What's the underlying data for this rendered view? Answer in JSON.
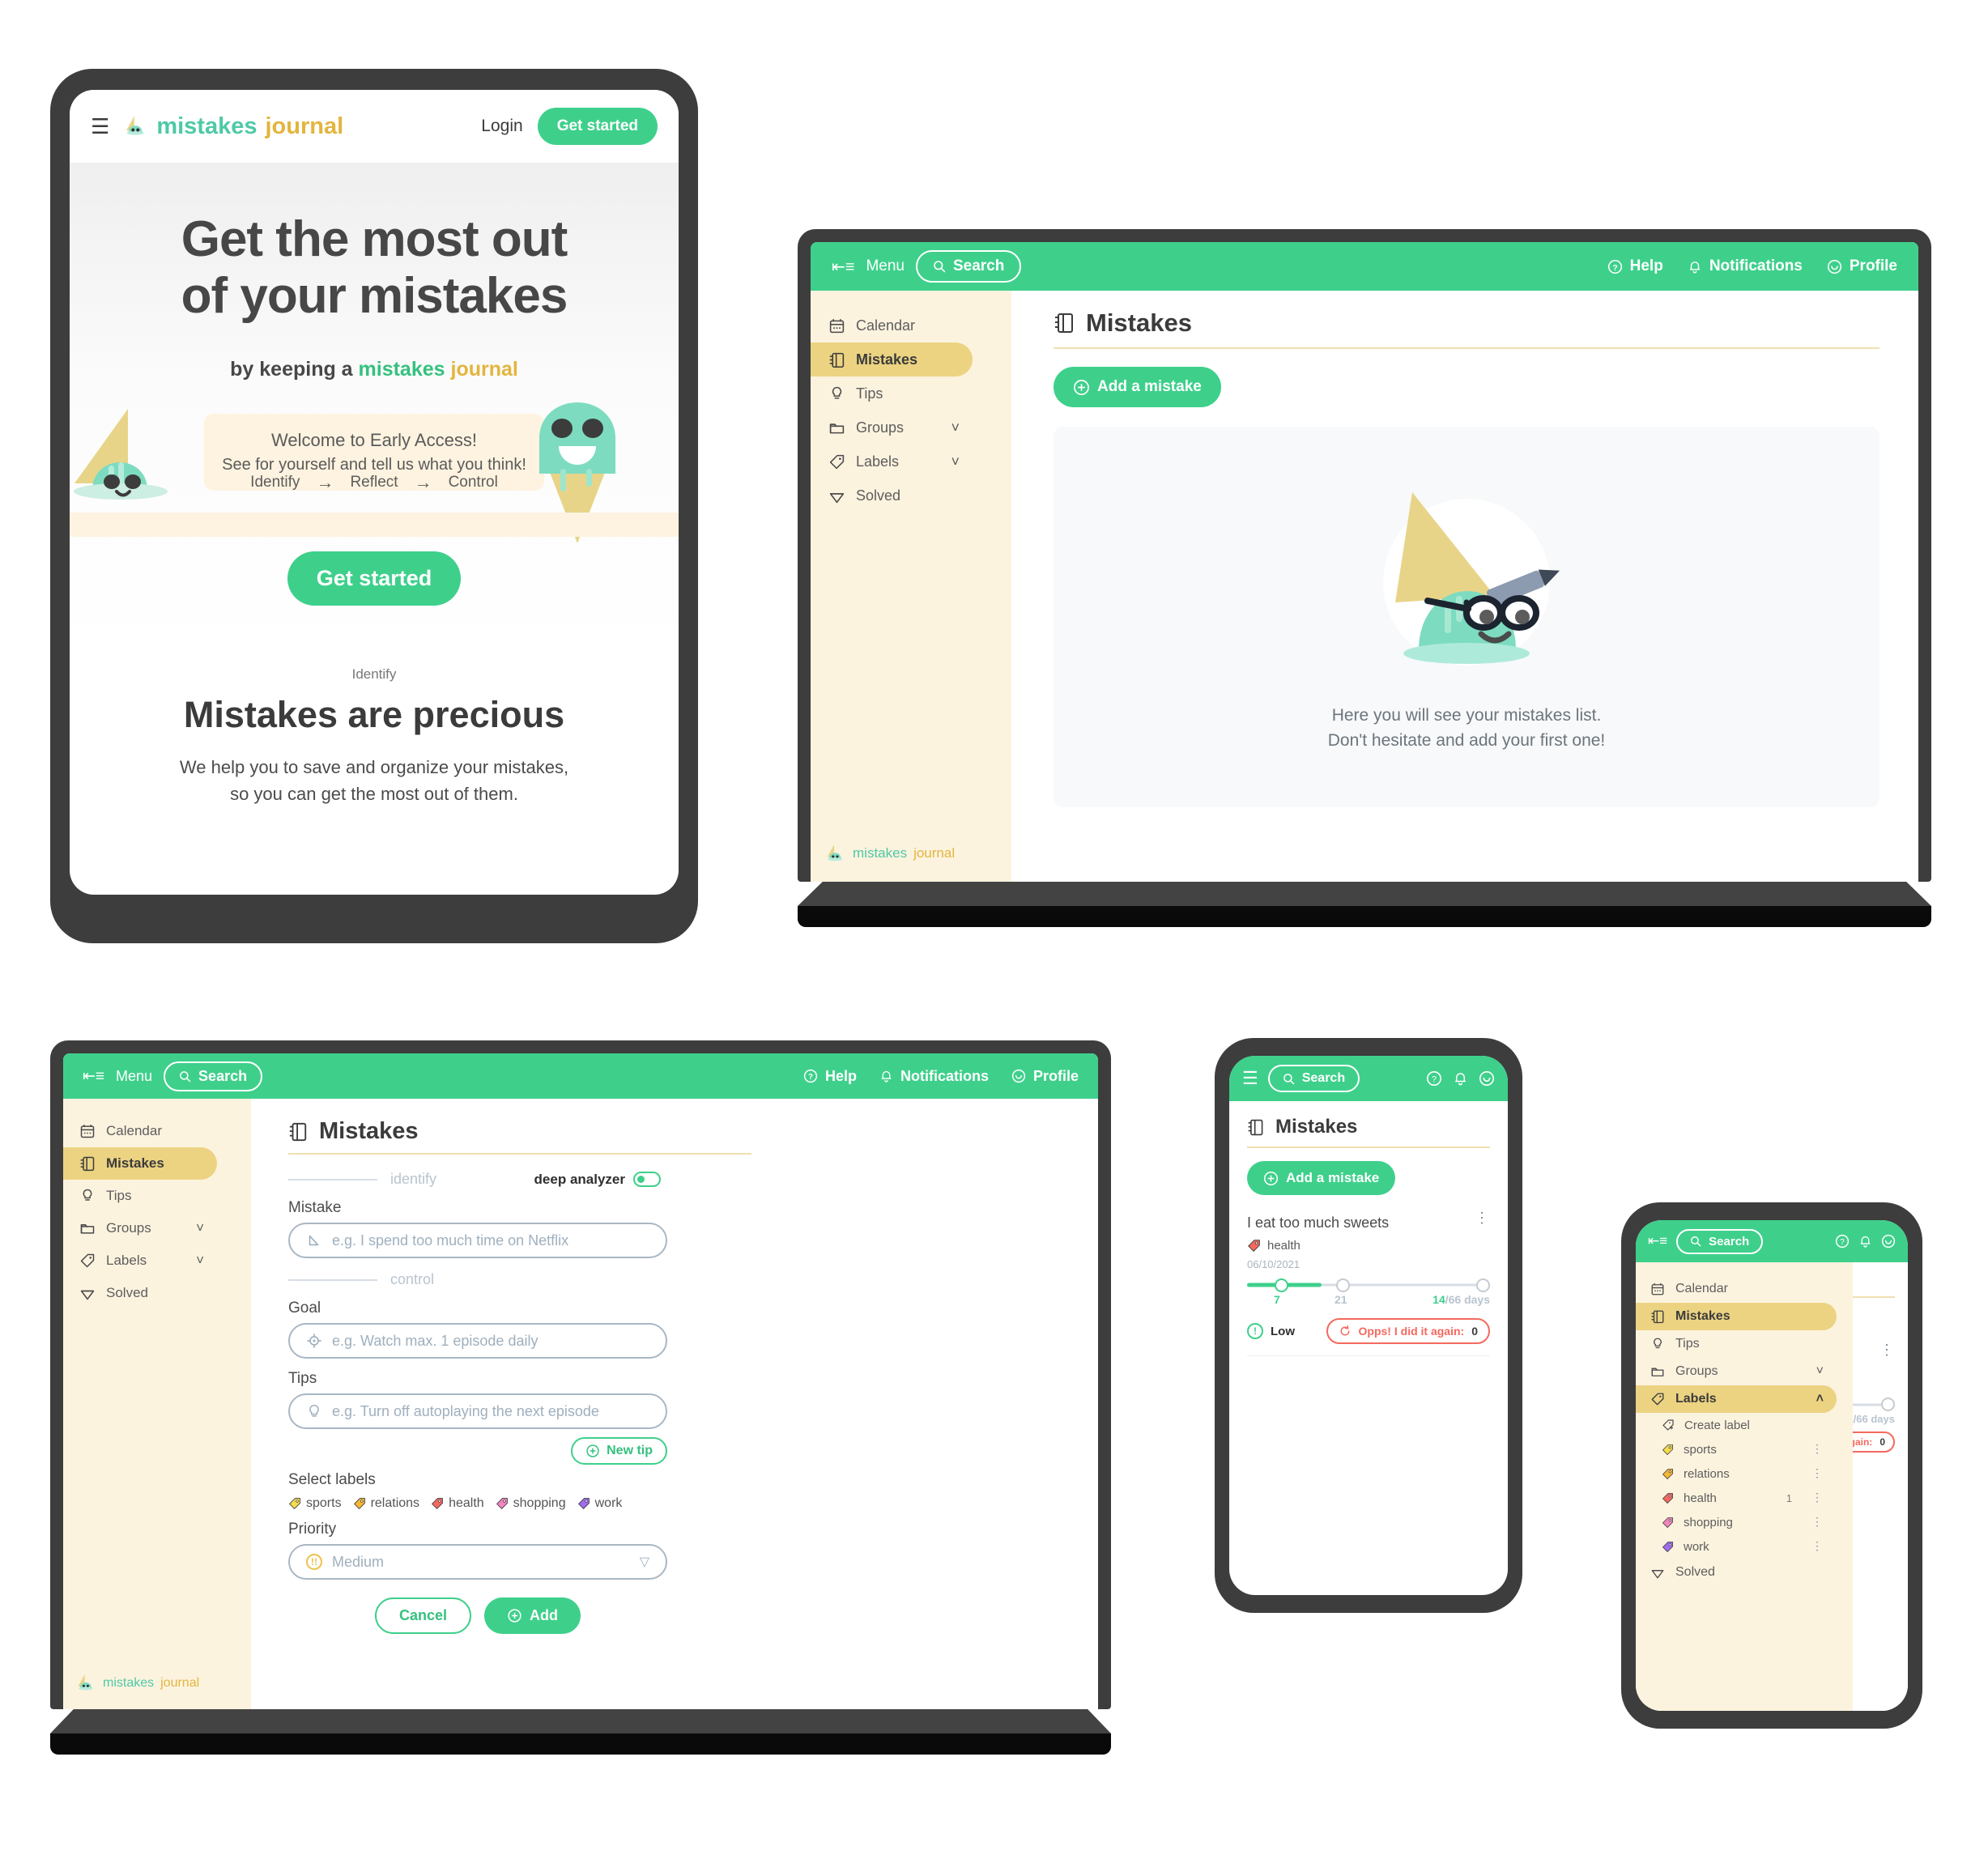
{
  "brand": {
    "name_first": "mistakes",
    "name_second": "journal"
  },
  "landing": {
    "nav": {
      "menu_icon": "hamburger-icon",
      "login": "Login",
      "cta": "Get started"
    },
    "hero": {
      "title_line1": "Get the most out",
      "title_line2": "of your mistakes",
      "subtitle_prefix": "by keeping a ",
      "subtitle_first": "mistakes",
      "subtitle_second": "journal",
      "notice_title": "Welcome to Early Access!",
      "notice_body": "See for yourself and tell us what you think!",
      "steps": [
        "Identify",
        "Reflect",
        "Control"
      ],
      "arrow": "→",
      "cta": "Get started"
    },
    "section": {
      "kicker": "Identify",
      "heading": "Mistakes are precious",
      "body_line1": "We help you to save and organize your mistakes,",
      "body_line2": "so you can get the most out of them."
    }
  },
  "appbar": {
    "menu_label": "Menu",
    "search_label": "Search",
    "help_label": "Help",
    "notifications_label": "Notifications",
    "profile_label": "Profile"
  },
  "sidebar": {
    "items": [
      {
        "label": "Calendar",
        "icon": "calendar-icon",
        "active": false,
        "chevron": ""
      },
      {
        "label": "Mistakes",
        "icon": "notebook-icon",
        "active": true,
        "chevron": ""
      },
      {
        "label": "Tips",
        "icon": "bulb-icon",
        "active": false,
        "chevron": ""
      },
      {
        "label": "Groups",
        "icon": "folder-icon",
        "active": false,
        "chevron": "˅"
      },
      {
        "label": "Labels",
        "icon": "tag-icon",
        "active": false,
        "chevron": "˅"
      },
      {
        "label": "Solved",
        "icon": "gem-icon",
        "active": false,
        "chevron": ""
      }
    ],
    "labels_expanded": {
      "create_label": "Create label",
      "items": [
        {
          "label": "sports",
          "color": "#f4dd4b",
          "count": ""
        },
        {
          "label": "relations",
          "color": "#f7b733",
          "count": ""
        },
        {
          "label": "health",
          "color": "#f4695f",
          "count": "1"
        },
        {
          "label": "shopping",
          "color": "#f485c0",
          "count": ""
        },
        {
          "label": "work",
          "color": "#a06cf0",
          "count": ""
        }
      ]
    }
  },
  "mistakes_page": {
    "title": "Mistakes",
    "add_button": "Add a mistake",
    "empty_line1": "Here you will see your mistakes list.",
    "empty_line2": "Don't hesitate and add your first one!"
  },
  "add_form": {
    "section_identify": "identify",
    "section_control": "control",
    "deep_analyzer_label": "deep analyzer",
    "deep_analyzer_on": true,
    "mistake_label": "Mistake",
    "mistake_placeholder": "e.g. I spend too much time on Netflix",
    "goal_label": "Goal",
    "goal_placeholder": "e.g. Watch max. 1 episode daily",
    "tips_label": "Tips",
    "tips_placeholder": "e.g. Turn off autoplaying the next episode",
    "new_tip_button": "New tip",
    "select_labels_label": "Select labels",
    "labels": [
      {
        "label": "sports",
        "color": "#f4dd4b"
      },
      {
        "label": "relations",
        "color": "#f7b733"
      },
      {
        "label": "health",
        "color": "#f4695f"
      },
      {
        "label": "shopping",
        "color": "#f485c0"
      },
      {
        "label": "work",
        "color": "#a06cf0"
      }
    ],
    "priority_label": "Priority",
    "priority_value": "Medium",
    "cancel_button": "Cancel",
    "add_button": "Add"
  },
  "mistake_card": {
    "title": "I eat too much sweets",
    "label": "health",
    "label_color": "#f4695f",
    "date": "06/10/2021",
    "milestone_1": "7",
    "milestone_2": "21",
    "progress_current": "14",
    "progress_total": "/66 days",
    "priority": "Low",
    "again_label": "Opps! I did it again:",
    "again_count": "0"
  },
  "colors": {
    "green": "#3ed08b",
    "cream": "#fcf3df",
    "active_yellow": "#ecd382",
    "sand": "#ecd382",
    "red": "#f4695f"
  }
}
